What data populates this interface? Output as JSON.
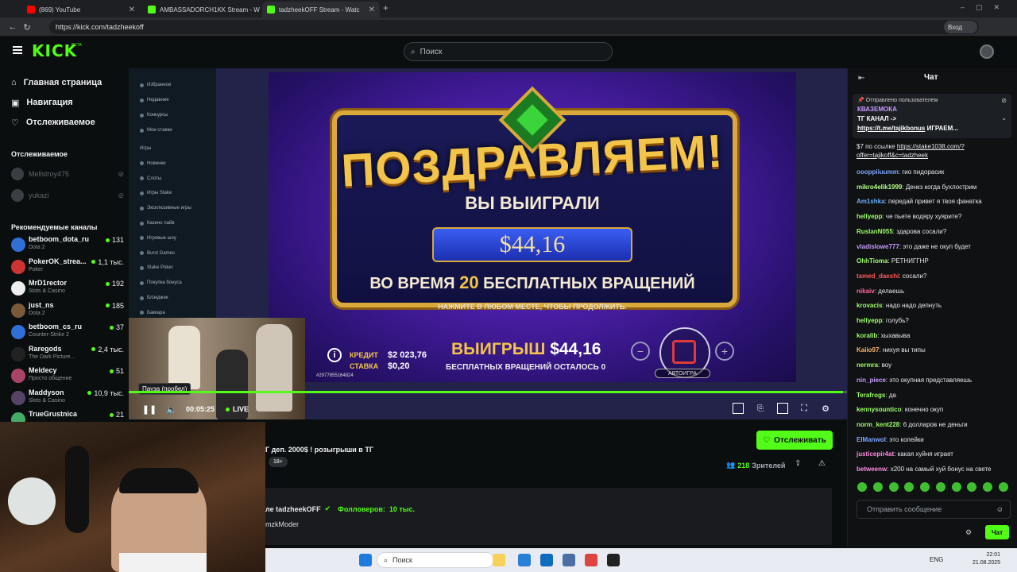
{
  "browser": {
    "tabs": [
      {
        "title": "(869) YouTube",
        "active": false,
        "icon_color": "#ff0000"
      },
      {
        "title": "AMBASSADORCH1KK Stream - W",
        "active": false,
        "icon_color": "#53fc18"
      },
      {
        "title": "tadzheekOFF Stream - Watc",
        "active": true,
        "icon_color": "#53fc18"
      }
    ],
    "new_tab_label": "+",
    "url": "https://kick.com/tadzheekoff",
    "profile_label": "Вход"
  },
  "header": {
    "logo": "KICK",
    "logo_beta": "BETA",
    "search_placeholder": "Поиск"
  },
  "sidebar": {
    "nav": [
      {
        "label": "Главная страница",
        "icon": "home-icon"
      },
      {
        "label": "Навигация",
        "icon": "browse-icon"
      },
      {
        "label": "Отслеживаемое",
        "icon": "heart-icon"
      }
    ],
    "following_title": "Отслеживаемое",
    "following": [
      {
        "name": "Mellstroy475"
      },
      {
        "name": "yukazi"
      }
    ],
    "recommended_title": "Рекомендуемые каналы",
    "recommended": [
      {
        "name": "betboom_dota_ru",
        "category": "Dota 2",
        "viewers": "131",
        "color": "#2f6fd6"
      },
      {
        "name": "PokerOK_strea...",
        "category": "Poker",
        "viewers": "1,1 тыс.",
        "color": "#c33"
      },
      {
        "name": "MrD1rector",
        "category": "Slots & Casino",
        "viewers": "192",
        "color": "#eee"
      },
      {
        "name": "just_ns",
        "category": "Dota 2",
        "viewers": "185",
        "color": "#7a5a3a"
      },
      {
        "name": "betboom_cs_ru",
        "category": "Counter-Strike 2",
        "viewers": "37",
        "color": "#2f6fd6"
      },
      {
        "name": "Raregods",
        "category": "The Dark Picture...",
        "viewers": "2,4 тыс.",
        "color": "#222"
      },
      {
        "name": "Meldecy",
        "category": "Просто общение",
        "viewers": "51",
        "color": "#a46"
      },
      {
        "name": "Maddyson",
        "category": "Slots & Casino",
        "viewers": "10,9 тыс.",
        "color": "#546"
      },
      {
        "name": "TrueGrustnica",
        "category": "",
        "viewers": "21",
        "color": "#4a6"
      }
    ]
  },
  "video": {
    "casino_nav": [
      "Избранное",
      "Недавние",
      "Конкурсы",
      "Мои ставки",
      "Игры",
      "Новинки",
      "Слоты",
      "Игры Stake",
      "Эксклюзивные игры",
      "Казино лайв",
      "Игровые шоу",
      "Burst Games",
      "Stake Poker",
      "Покупка бонуса",
      "Блэкджек",
      "Баккара"
    ],
    "congrats": "ПОЗДРАВЛЯЕМ!",
    "you_won": "ВЫ ВЫИГРАЛИ",
    "win_amount": "$44,16",
    "during_pre": "ВО ВРЕМЯ",
    "during_num": "20",
    "during_post": "БЕСПЛАТНЫХ ВРАЩЕНИЙ",
    "tap_continue": "НАЖМИТЕ В ЛЮБОМ МЕСТЕ, ЧТОБЫ ПРОДОЛЖИТЬ.",
    "credit_label": "КРЕДИТ",
    "credit_value": "$2 023,76",
    "bet_label": "СТАВКА",
    "bet_value": "$0,20",
    "win_label": "ВЫИГРЫШ",
    "win_value": "$44,16",
    "free_spins_left": "БЕСПЛАТНЫХ ВРАЩЕНИЙ ОСТАЛОСЬ",
    "free_spins_count": "0",
    "autoplay": "АВТОИГРА",
    "bet_id": "#2977855164824",
    "tooltip": "Пауза (пробел)",
    "time": "00:05:25",
    "live": "LIVE",
    "progress": 0.995
  },
  "stream_info": {
    "title_fragment": "Г деп. 2000$ ! розыгрыши в ТГ",
    "age_badge": "18+",
    "viewers": "218",
    "viewers_label": "Зрителей",
    "follow_label": "Отслеживать",
    "about_prefix": "ле tadzheekOFF",
    "followers_label": "Фолловеров:",
    "followers_count": "10 тыс.",
    "mod_name": "mzkModer"
  },
  "chat": {
    "title": "Чат",
    "pinned_by": "Отправлено пользователем",
    "pinned_user": "КВАЗЕМОКА",
    "pinned_line1": "ТГ КАНАЛ ->",
    "pinned_link": "https://t.me/tajikbonus",
    "pinned_tail": "ИГРАЕМ...",
    "messages": [
      {
        "user": "",
        "text": "$7 по ссылке",
        "link": "https://stake1038.com/?offer=tajikoff&c=tadzheek",
        "color": "#e8eaec"
      },
      {
        "user": "oooppiiuumm",
        "text": "гио пидорасик",
        "color": "#7fa6ff"
      },
      {
        "user": "mikro4elik1999",
        "text": "Денкз когда бухлострим",
        "color": "#b6ff8a"
      },
      {
        "user": "Am1shka",
        "text": "передай привет я твоя фанатка",
        "color": "#6ab0ff"
      },
      {
        "user": "hellyepp",
        "text": "че пьете водяру хуярите?",
        "color": "#9fff6a"
      },
      {
        "user": "RuslanN055",
        "text": "здарова сосали?",
        "color": "#9fff6a"
      },
      {
        "user": "vladislowe777",
        "text": "это даже не окуп будет",
        "color": "#c89bff"
      },
      {
        "user": "OhhTioma",
        "text": "РЕТНИГГНР",
        "color": "#9fff6a"
      },
      {
        "user": "tamed_daeshi",
        "text": "сосали?",
        "color": "#ff5a5a"
      },
      {
        "user": "nikaiv",
        "text": "делаешь",
        "color": "#ff6a9a"
      },
      {
        "user": "krovacis",
        "text": "надо надо депнуть",
        "color": "#9fff6a"
      },
      {
        "user": "hellyepp",
        "text": "голубь?",
        "color": "#9fff6a"
      },
      {
        "user": "koralib",
        "text": "хыхавыва",
        "color": "#9fff6a"
      },
      {
        "user": "Kaiio97",
        "text": "нихуя вы типы",
        "color": "#ffb46a"
      },
      {
        "user": "nermra",
        "text": "воу",
        "color": "#9fff6a"
      },
      {
        "user": "nin_piece",
        "text": "это окупная представляешь",
        "color": "#c89bff"
      },
      {
        "user": "Terafrogs",
        "text": "да",
        "color": "#9fff6a"
      },
      {
        "user": "kennysountico",
        "text": "конечно окуп",
        "color": "#9fff6a"
      },
      {
        "user": "norm_kent228",
        "text": "6 долларов не деньги",
        "color": "#9fff6a"
      },
      {
        "user": "ElManwol",
        "text": "это копейки",
        "color": "#7fa6ff"
      },
      {
        "user": "justicepir4at",
        "text": "какая хуйня играет",
        "color": "#ff8ae0"
      },
      {
        "user": "betweenw",
        "text": "x200 на самый хуй бонус на свете",
        "color": "#ff8ae0"
      }
    ],
    "input_placeholder": "Отправить сообщение",
    "send_label": "Чат"
  },
  "taskbar": {
    "search_label": "Поиск",
    "lang": "ENG",
    "time": "22:01",
    "date": "21.08.2025"
  }
}
